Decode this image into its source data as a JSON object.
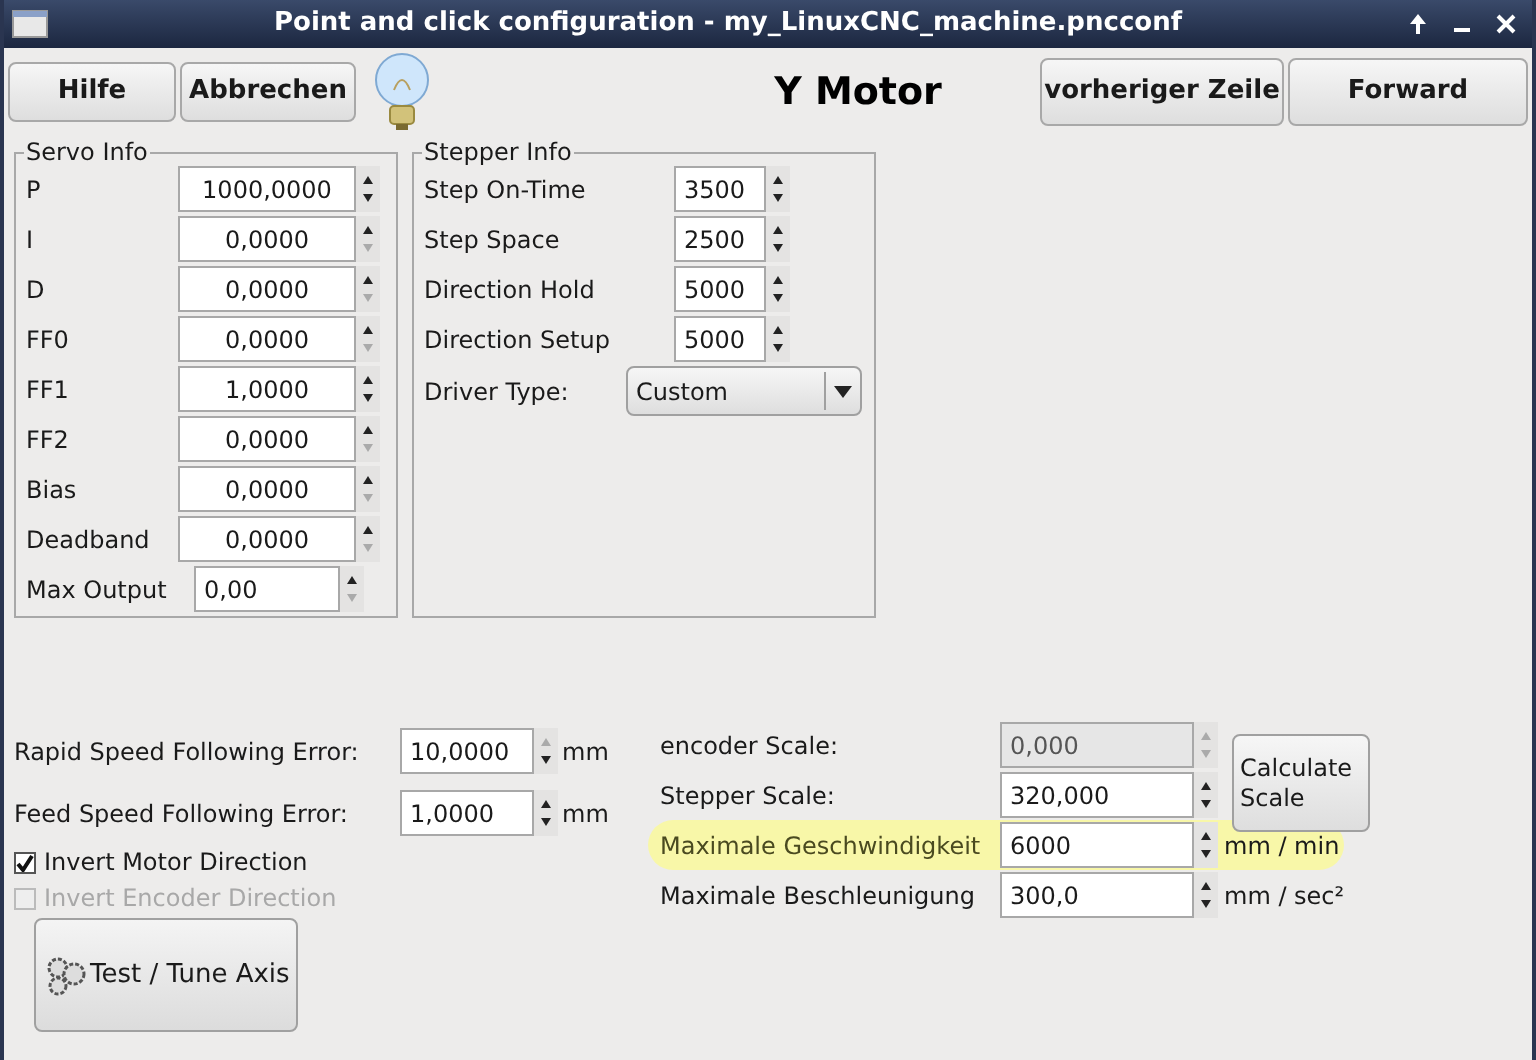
{
  "window": {
    "title": "Point and click configuration - my_LinuxCNC_machine.pncconf"
  },
  "toolbar": {
    "buttons": [
      {
        "label": "Hilfe"
      },
      {
        "label": "Abbrechen"
      }
    ],
    "heading": "Y Motor",
    "nav_buttons": [
      {
        "label": "vorheriger Zeile"
      },
      {
        "label": "Forward"
      }
    ]
  },
  "servo_info": {
    "title": "Servo Info",
    "rows": [
      {
        "label": "P",
        "value": "1000,0000",
        "up_enabled": true,
        "down_enabled": true
      },
      {
        "label": "I",
        "value": "0,0000",
        "up_enabled": true,
        "down_enabled": false
      },
      {
        "label": "D",
        "value": "0,0000",
        "up_enabled": true,
        "down_enabled": false
      },
      {
        "label": "FF0",
        "value": "0,0000",
        "up_enabled": true,
        "down_enabled": false
      },
      {
        "label": "FF1",
        "value": "1,0000",
        "up_enabled": true,
        "down_enabled": true
      },
      {
        "label": "FF2",
        "value": "0,0000",
        "up_enabled": true,
        "down_enabled": false
      },
      {
        "label": "Bias",
        "value": "0,0000",
        "up_enabled": true,
        "down_enabled": false
      },
      {
        "label": "Deadband",
        "value": "0,0000",
        "up_enabled": true,
        "down_enabled": false
      }
    ],
    "max_output": {
      "label": "Max Output",
      "value": "0,00",
      "up_enabled": true,
      "down_enabled": false
    }
  },
  "stepper_info": {
    "title": "Stepper Info",
    "rows": [
      {
        "label": "Step On-Time",
        "value": "3500",
        "up_enabled": true,
        "down_enabled": true
      },
      {
        "label": "Step Space",
        "value": "2500",
        "up_enabled": true,
        "down_enabled": true
      },
      {
        "label": "Direction Hold",
        "value": "5000",
        "up_enabled": true,
        "down_enabled": true
      },
      {
        "label": "Direction Setup",
        "value": "5000",
        "up_enabled": true,
        "down_enabled": true
      }
    ],
    "driver_type": {
      "label": "Driver Type:",
      "value": "Custom"
    }
  },
  "following_errors": [
    {
      "label": "Rapid Speed Following Error:",
      "value": "10,0000",
      "unit": "mm",
      "up_enabled": false,
      "down_enabled": true
    },
    {
      "label": "Feed Speed Following Error:",
      "value": "1,0000",
      "unit": "mm",
      "up_enabled": true,
      "down_enabled": true
    }
  ],
  "checkboxes": [
    {
      "label": "Invert Motor Direction",
      "checked": true,
      "disabled": false
    },
    {
      "label": "Invert Encoder Direction",
      "checked": false,
      "disabled": true
    }
  ],
  "test_button": {
    "label": "Test / Tune Axis"
  },
  "scales": [
    {
      "label": "encoder Scale:",
      "value": "0,000",
      "disabled": true,
      "highlighted": false,
      "up_enabled": false,
      "down_enabled": false
    },
    {
      "label": "Stepper Scale:",
      "value": "320,000",
      "disabled": false,
      "highlighted": false,
      "up_enabled": true,
      "down_enabled": true
    },
    {
      "label": "Maximale Geschwindigkeit",
      "value": "6000",
      "unit": "mm / min",
      "disabled": false,
      "highlighted": true,
      "up_enabled": true,
      "down_enabled": true
    },
    {
      "label": "Maximale Beschleunigung",
      "value": "300,0",
      "unit": "mm / sec²",
      "disabled": false,
      "highlighted": false,
      "up_enabled": true,
      "down_enabled": true
    }
  ],
  "calculate_button": {
    "label": "Calculate Scale"
  }
}
